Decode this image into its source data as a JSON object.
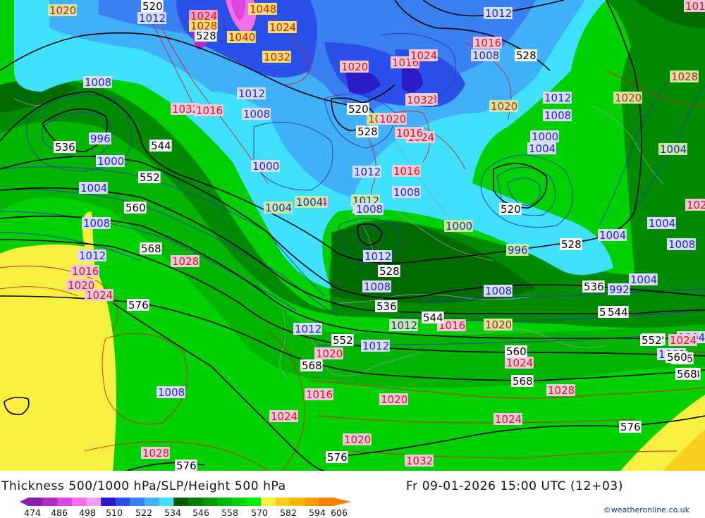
{
  "title": "Thickness 500/1000 hPa/SLP/Height 500 hPa",
  "valid_time": "Fr 09-01-2026 15:00 UTC (12+03)",
  "credit": "©weatheronline.co.uk",
  "legend": {
    "ticks": [
      "474",
      "486",
      "498",
      "510",
      "522",
      "534",
      "546",
      "558",
      "570",
      "582",
      "594",
      "606"
    ],
    "colors": [
      "#8a1fa8",
      "#b42cc8",
      "#d848e0",
      "#f070e8",
      "#f0a0f0",
      "#2a1ac8",
      "#2a50e8",
      "#3a80f0",
      "#40b0f8",
      "#40e0ff",
      "#005a00",
      "#007c00",
      "#009a00",
      "#00b800",
      "#00d400",
      "#00ee00",
      "#f8f040",
      "#f8d020",
      "#f8b800",
      "#f89c00",
      "#f88000"
    ]
  },
  "map": {
    "pressure_labels": [
      {
        "text": "1020",
        "fill": "#cce8a0",
        "color": "#d01818"
      },
      {
        "text": "1012",
        "fill": "#d8dcf8",
        "color": "#1a2ab8"
      },
      {
        "text": "1024",
        "fill": "#f0a0d0",
        "color": "#d01818"
      },
      {
        "text": "1028",
        "fill": "#f8e070",
        "color": "#d01818"
      },
      {
        "text": "1048",
        "fill": "#f8e070",
        "color": "#d01818"
      },
      {
        "text": "1040",
        "fill": "#f8e070",
        "color": "#d01818"
      },
      {
        "text": "1032",
        "fill": "#f8e070",
        "color": "#d01818"
      },
      {
        "text": "1024",
        "fill": "#f8e070",
        "color": "#d01818"
      },
      {
        "text": "1020",
        "fill": "#f0c8dc",
        "color": "#d01818"
      },
      {
        "text": "1016",
        "fill": "#f0c8dc",
        "color": "#d01818"
      },
      {
        "text": "1024",
        "fill": "#f0c8dc",
        "color": "#d01818"
      },
      {
        "text": "1028",
        "fill": "#f0c8dc",
        "color": "#d01818"
      },
      {
        "text": "1032",
        "fill": "#f0c8dc",
        "color": "#d01818"
      },
      {
        "text": "1008",
        "fill": "#d8dcf8",
        "color": "#1a2ab8"
      },
      {
        "text": "1016",
        "fill": "#f0c8dc",
        "color": "#d01818"
      },
      {
        "text": "1020",
        "fill": "#cce8a0",
        "color": "#d01818"
      },
      {
        "text": "1012",
        "fill": "#d8dcf8",
        "color": "#1a2ab8"
      },
      {
        "text": "1008",
        "fill": "#d8dcf8",
        "color": "#1a2ab8"
      },
      {
        "text": "1016",
        "fill": "#f0c8dc",
        "color": "#d01818"
      },
      {
        "text": "1012",
        "fill": "#d8dcf8",
        "color": "#1a2ab8"
      },
      {
        "text": "1008",
        "fill": "#d8dcf8",
        "color": "#1a2ab8"
      },
      {
        "text": "996",
        "fill": "#d8dcf8",
        "color": "#1a2ab8"
      },
      {
        "text": "1000",
        "fill": "#d8dcf8",
        "color": "#1a2ab8"
      },
      {
        "text": "1004",
        "fill": "#d8dcf8",
        "color": "#1a2ab8"
      },
      {
        "text": "1008",
        "fill": "#d8dcf8",
        "color": "#1a2ab8"
      },
      {
        "text": "1012",
        "fill": "#d8dcf8",
        "color": "#1a2ab8"
      },
      {
        "text": "1016",
        "fill": "#f0c8dc",
        "color": "#d01818"
      },
      {
        "text": "1020",
        "fill": "#f0c8dc",
        "color": "#d01818"
      },
      {
        "text": "1024",
        "fill": "#f0c8dc",
        "color": "#d01818"
      },
      {
        "text": "1028",
        "fill": "#f0c8dc",
        "color": "#d01818"
      },
      {
        "text": "1012",
        "fill": "#d8dcf8",
        "color": "#1a2ab8"
      },
      {
        "text": "1008",
        "fill": "#d8dcf8",
        "color": "#1a2ab8"
      },
      {
        "text": "1000",
        "fill": "#d8dcf8",
        "color": "#1a2ab8"
      },
      {
        "text": "1004",
        "fill": "#d8dcf8",
        "color": "#1a2ab8"
      },
      {
        "text": "1004",
        "fill": "#cce8a0",
        "color": "#1a2ab8"
      },
      {
        "text": "1000",
        "fill": "#d8dcf8",
        "color": "#1a2ab8"
      },
      {
        "text": "996",
        "fill": "#d8dcf8",
        "color": "#1a2ab8"
      },
      {
        "text": "1012",
        "fill": "#d8dcf8",
        "color": "#1a2ab8"
      },
      {
        "text": "1016",
        "fill": "#f0c8dc",
        "color": "#d01818"
      },
      {
        "text": "1008",
        "fill": "#d8dcf8",
        "color": "#1a2ab8"
      },
      {
        "text": "1020",
        "fill": "#f0c8dc",
        "color": "#d01818"
      },
      {
        "text": "1024",
        "fill": "#f0c8dc",
        "color": "#d01818"
      },
      {
        "text": "1032",
        "fill": "#f0c8dc",
        "color": "#d01818"
      },
      {
        "text": "1016",
        "fill": "#f0c8dc",
        "color": "#d01818"
      },
      {
        "text": "1020",
        "fill": "#cce8a0",
        "color": "#d01818"
      },
      {
        "text": "1028",
        "fill": "#cce8a0",
        "color": "#d01818"
      },
      {
        "text": "1024",
        "fill": "#f0c8dc",
        "color": "#d01818"
      },
      {
        "text": "1020",
        "fill": "#cce8a0",
        "color": "#d01818"
      },
      {
        "text": "1012",
        "fill": "#cce8a0",
        "color": "#1a2ab8"
      },
      {
        "text": "1008",
        "fill": "#d8dcf8",
        "color": "#1a2ab8"
      },
      {
        "text": "1000",
        "fill": "#cce8a0",
        "color": "#1a2ab8"
      },
      {
        "text": "996",
        "fill": "#cce8a0",
        "color": "#1a2ab8"
      },
      {
        "text": "1004",
        "fill": "#cce8a0",
        "color": "#1a2ab8"
      },
      {
        "text": "1004",
        "fill": "#cce8a0",
        "color": "#1a2ab8"
      },
      {
        "text": "1008",
        "fill": "#d8dcf8",
        "color": "#1a2ab8"
      },
      {
        "text": "1004",
        "fill": "#d8dcf8",
        "color": "#1a2ab8"
      },
      {
        "text": "1004",
        "fill": "#d8dcf8",
        "color": "#1a2ab8"
      },
      {
        "text": "1008",
        "fill": "#d8dcf8",
        "color": "#1a2ab8"
      },
      {
        "text": "1008",
        "fill": "#d8dcf8",
        "color": "#1a2ab8"
      },
      {
        "text": "1012",
        "fill": "#d8dcf8",
        "color": "#1a2ab8"
      },
      {
        "text": "1012",
        "fill": "#cce8a0",
        "color": "#1a2ab8"
      },
      {
        "text": "1016",
        "fill": "#f0c8dc",
        "color": "#d01818"
      },
      {
        "text": "1020",
        "fill": "#cce8a0",
        "color": "#d01818"
      },
      {
        "text": "992",
        "fill": "#d8dcf8",
        "color": "#1a2ab8"
      },
      {
        "text": "1004",
        "fill": "#d8dcf8",
        "color": "#1a2ab8"
      },
      {
        "text": "1008",
        "fill": "#d8dcf8",
        "color": "#1a2ab8"
      },
      {
        "text": "1004",
        "fill": "#d8dcf8",
        "color": "#1a2ab8"
      },
      {
        "text": "1012",
        "fill": "#d8dcf8",
        "color": "#1a2ab8"
      },
      {
        "text": "1012",
        "fill": "#d8dcf8",
        "color": "#1a2ab8"
      },
      {
        "text": "1008",
        "fill": "#d8dcf8",
        "color": "#1a2ab8"
      },
      {
        "text": "1016",
        "fill": "#f0c8dc",
        "color": "#d01818"
      },
      {
        "text": "1020",
        "fill": "#f0c8dc",
        "color": "#d01818"
      },
      {
        "text": "1024",
        "fill": "#f0c8dc",
        "color": "#d01818"
      },
      {
        "text": "1020",
        "fill": "#f0c8dc",
        "color": "#d01818"
      },
      {
        "text": "1024",
        "fill": "#f0c8dc",
        "color": "#d01818"
      },
      {
        "text": "1028",
        "fill": "#f0c8dc",
        "color": "#d01818"
      },
      {
        "text": "1032",
        "fill": "#f0c8dc",
        "color": "#d01818"
      },
      {
        "text": "1028",
        "fill": "#f0c8dc",
        "color": "#d01818"
      },
      {
        "text": "1024",
        "fill": "#f0c8dc",
        "color": "#d01818"
      },
      {
        "text": "1020",
        "fill": "#f0c8dc",
        "color": "#d01818"
      },
      {
        "text": "1024",
        "fill": "#f0c8dc",
        "color": "#d01818"
      },
      {
        "text": "1024",
        "fill": "#f0c8dc",
        "color": "#d01818"
      },
      {
        "text": "1016",
        "fill": "#f0c8dc",
        "color": "#d01818"
      },
      {
        "text": "1012",
        "fill": "#cce8a0",
        "color": "#1a2ab8"
      },
      {
        "text": "1000",
        "fill": "#d8dcf8",
        "color": "#1a2ab8"
      }
    ],
    "height_labels": [
      "520",
      "528",
      "528",
      "520",
      "528",
      "536",
      "544",
      "552",
      "560",
      "568",
      "576",
      "576",
      "576",
      "560",
      "568",
      "576",
      "536",
      "544",
      "552",
      "560",
      "568",
      "520",
      "528",
      "536",
      "544",
      "552",
      "568",
      "528",
      "536",
      "544",
      "552",
      "560",
      "568"
    ]
  }
}
